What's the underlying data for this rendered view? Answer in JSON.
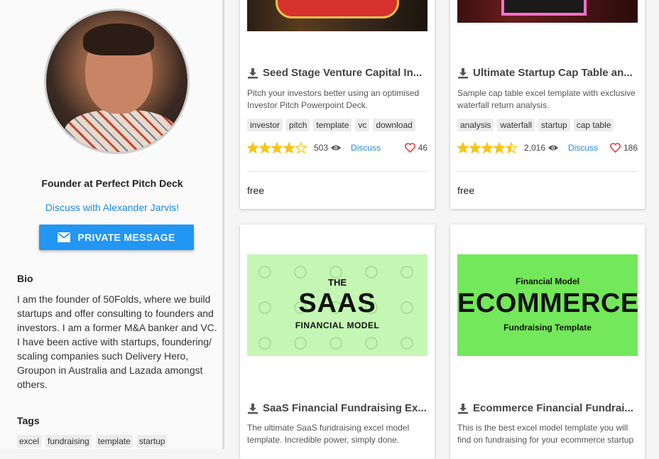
{
  "profile": {
    "role": "Founder at Perfect Pitch Deck",
    "discuss_link": "Discuss with Alexander Jarvis!",
    "private_message_label": "PRIVATE MESSAGE",
    "bio_heading": "Bio",
    "bio_text": "I am the founder of 50Folds, where we build startups and offer consulting to founders and investors. I am a former M&A banker and VC. I have been active with startups, foundering/ scaling companies such Delivery Hero, Groupon in Australia and Lazada amongst others.",
    "tags_heading": "Tags",
    "tags": [
      "excel",
      "fundraising",
      "template",
      "startup"
    ]
  },
  "cards": [
    {
      "title": "Seed Stage Venture Capital In...",
      "description": "Pitch your investors better using an optimised Investor Pitch Powerpoint Deck.",
      "tags": [
        "investor",
        "pitch",
        "template",
        "vc",
        "download"
      ],
      "rating": 4,
      "views": "503",
      "discuss_label": "Discuss",
      "likes": "46",
      "price": "free",
      "thumbnail_icon": "seed-stage-fundraising-banner"
    },
    {
      "title": "Ultimate Startup Cap Table an...",
      "description": "Sample cap table excel template with exclusive waterfall return analysis.",
      "tags": [
        "analysis",
        "waterfall",
        "startup",
        "cap table"
      ],
      "rating": 4.5,
      "views": "2,016",
      "discuss_label": "Discuss",
      "likes": "186",
      "price": "free",
      "thumbnail_icon": "cap-table-analysis-banner"
    },
    {
      "title": "SaaS Financial Fundraising Ex...",
      "description": "The ultimate SaaS fundraising excel model template. Incredible power, simply done.",
      "thumbnail": {
        "line1": "THE",
        "line2": "SAAS",
        "line3": "FINANCIAL MODEL"
      }
    },
    {
      "title": "Ecommerce Financial Fundrai...",
      "description": "This is the best excel model template you will find on fundraising for your ecommerce startup",
      "thumbnail": {
        "line1": "Financial Model",
        "line2": "ECOMMERCE",
        "line3": "Fundraising Template"
      }
    }
  ],
  "colors": {
    "accent": "#2196f3",
    "link": "#1e88e5",
    "star": "#f5c518",
    "heart": "#e53935",
    "saas_bg": "#c4f7b4",
    "ecom_bg": "#73e85a"
  }
}
